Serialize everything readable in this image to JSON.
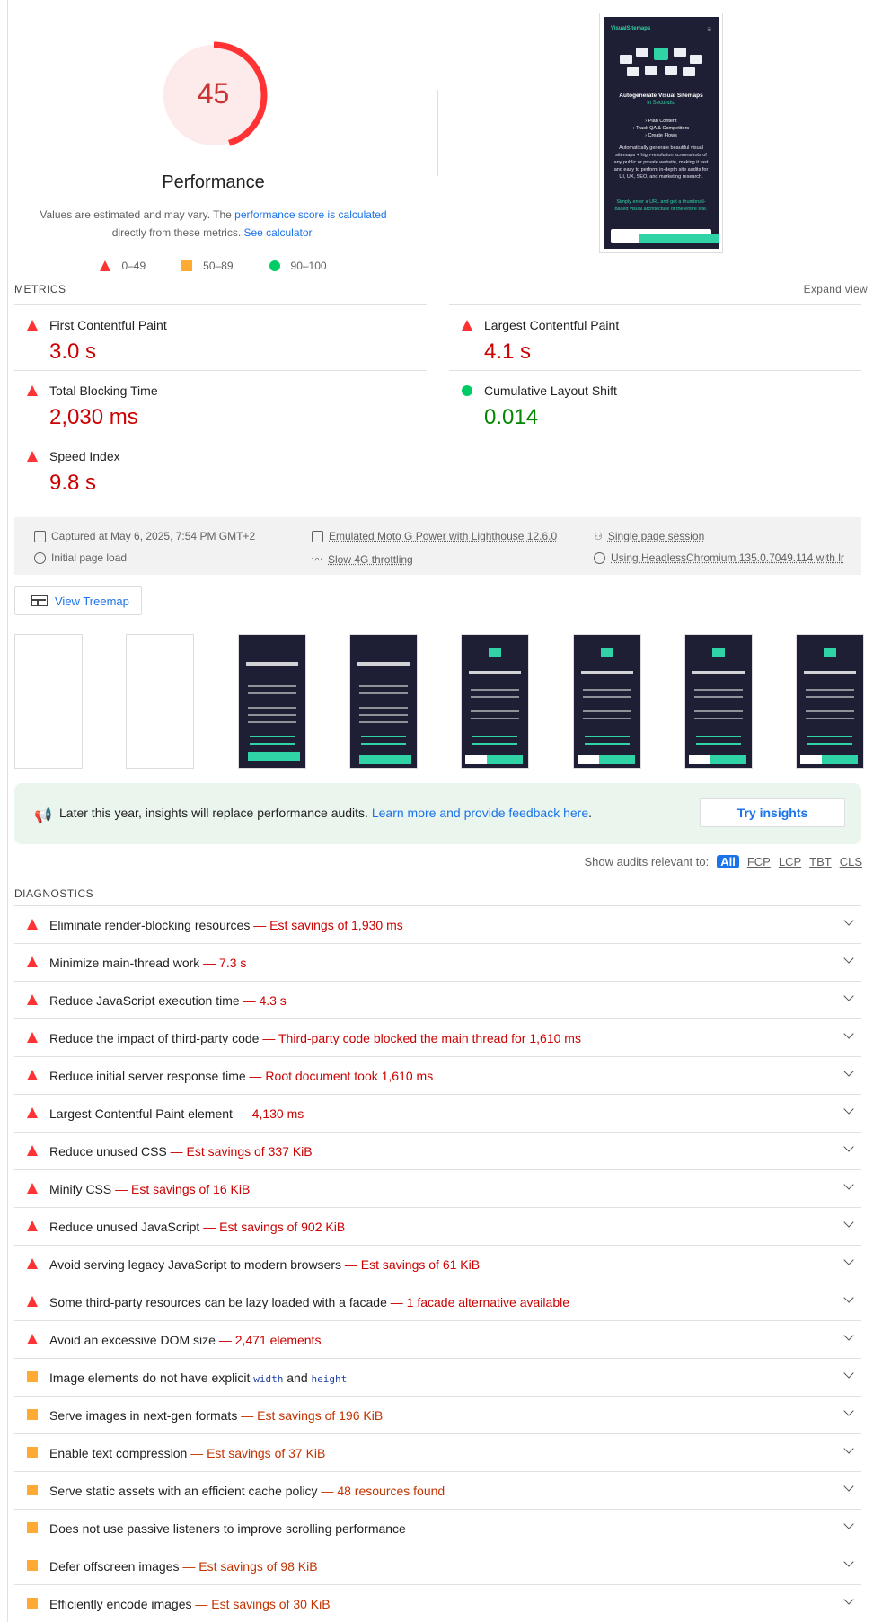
{
  "score": {
    "value": "45",
    "title": "Performance",
    "fraction": 0.45
  },
  "desc": {
    "pre": "Values are estimated and may vary. The ",
    "link1": "performance score is calculated",
    "mid": " directly from these metrics. ",
    "link2": "See calculator."
  },
  "legend": [
    {
      "label": "0–49"
    },
    {
      "label": "50–89"
    },
    {
      "label": "90–100"
    }
  ],
  "preview": {
    "logo": "VisualSitemaps",
    "heading": "Autogenerate Visual Sitemaps",
    "heading2": "in Seconds.",
    "list": [
      "› Plan Content",
      "› Track QA & Competitors",
      "› Create Flows"
    ],
    "body": "Automatically generate beautiful visual sitemaps + high-resolution screenshots of any public or private website, making it fast and easy to perform in-depth site audits for UI, UX, SEO, and marketing research.",
    "cta": "Simply enter a URL and get a thumbnail-based visual architecture of the entire site."
  },
  "metrics": {
    "label": "METRICS",
    "expand": "Expand view",
    "items": [
      {
        "name": "First Contentful Paint",
        "value": "3.0 s"
      },
      {
        "name": "Largest Contentful Paint",
        "value": "4.1 s"
      },
      {
        "name": "Total Blocking Time",
        "value": "2,030 ms"
      },
      {
        "name": "Cumulative Layout Shift",
        "value": "0.014"
      },
      {
        "name": "Speed Index",
        "value": "9.8 s"
      }
    ]
  },
  "env": {
    "captured": "Captured at May 6, 2025, 7:54 PM GMT+2",
    "initial": "Initial page load",
    "device": "Emulated Moto G Power with Lighthouse 12.6.0",
    "throttle": "Slow 4G throttling",
    "session": "Single page session",
    "browser": "Using HeadlessChromium 135.0.7049.114 with lr"
  },
  "treemap": "View Treemap",
  "insight": {
    "text": "Later this year, insights will replace performance audits. ",
    "link": "Learn more and provide feedback here",
    "dot": ".",
    "button": "Try insights"
  },
  "filter": {
    "label": "Show audits relevant to:",
    "opts": [
      "All",
      "FCP",
      "LCP",
      "TBT",
      "CLS"
    ]
  },
  "diagnostics": {
    "label": "DIAGNOSTICS",
    "items": [
      {
        "name": "Eliminate render-blocking resources",
        "savings": "— Est savings of 1,930 ms"
      },
      {
        "name": "Minimize main-thread work",
        "savings": "— 7.3 s"
      },
      {
        "name": "Reduce JavaScript execution time",
        "savings": "— 4.3 s"
      },
      {
        "name": "Reduce the impact of third-party code",
        "savings": "— Third-party code blocked the main thread for 1,610 ms"
      },
      {
        "name": "Reduce initial server response time",
        "savings": "— Root document took 1,610 ms"
      },
      {
        "name": "Largest Contentful Paint element",
        "savings": "— 4,130 ms"
      },
      {
        "name": "Reduce unused CSS",
        "savings": "— Est savings of 337 KiB"
      },
      {
        "name": "Minify CSS",
        "savings": "— Est savings of 16 KiB"
      },
      {
        "name": "Reduce unused JavaScript",
        "savings": "— Est savings of 902 KiB"
      },
      {
        "name": "Avoid serving legacy JavaScript to modern browsers",
        "savings": "— Est savings of 61 KiB"
      },
      {
        "name": "Some third-party resources can be lazy loaded with a facade",
        "savings": "— 1 facade alternative available"
      },
      {
        "name": "Avoid an excessive DOM size",
        "savings": "— 2,471 elements"
      },
      {
        "name": "Image elements do not have explicit",
        "code1": "width",
        "and": "and",
        "code2": "height"
      },
      {
        "name": "Serve images in next-gen formats",
        "savings": "— Est savings of 196 KiB"
      },
      {
        "name": "Enable text compression",
        "savings": "— Est savings of 37 KiB"
      },
      {
        "name": "Serve static assets with an efficient cache policy",
        "savings": "— 48 resources found"
      },
      {
        "name": "Does not use passive listeners to improve scrolling performance"
      },
      {
        "name": "Defer offscreen images",
        "savings": "— Est savings of 98 KiB"
      },
      {
        "name": "Efficiently encode images",
        "savings": "— Est savings of 30 KiB"
      }
    ]
  },
  "colors": {
    "fail": "#ff3333",
    "average": "#ffaa33",
    "pass": "#00cc66"
  }
}
